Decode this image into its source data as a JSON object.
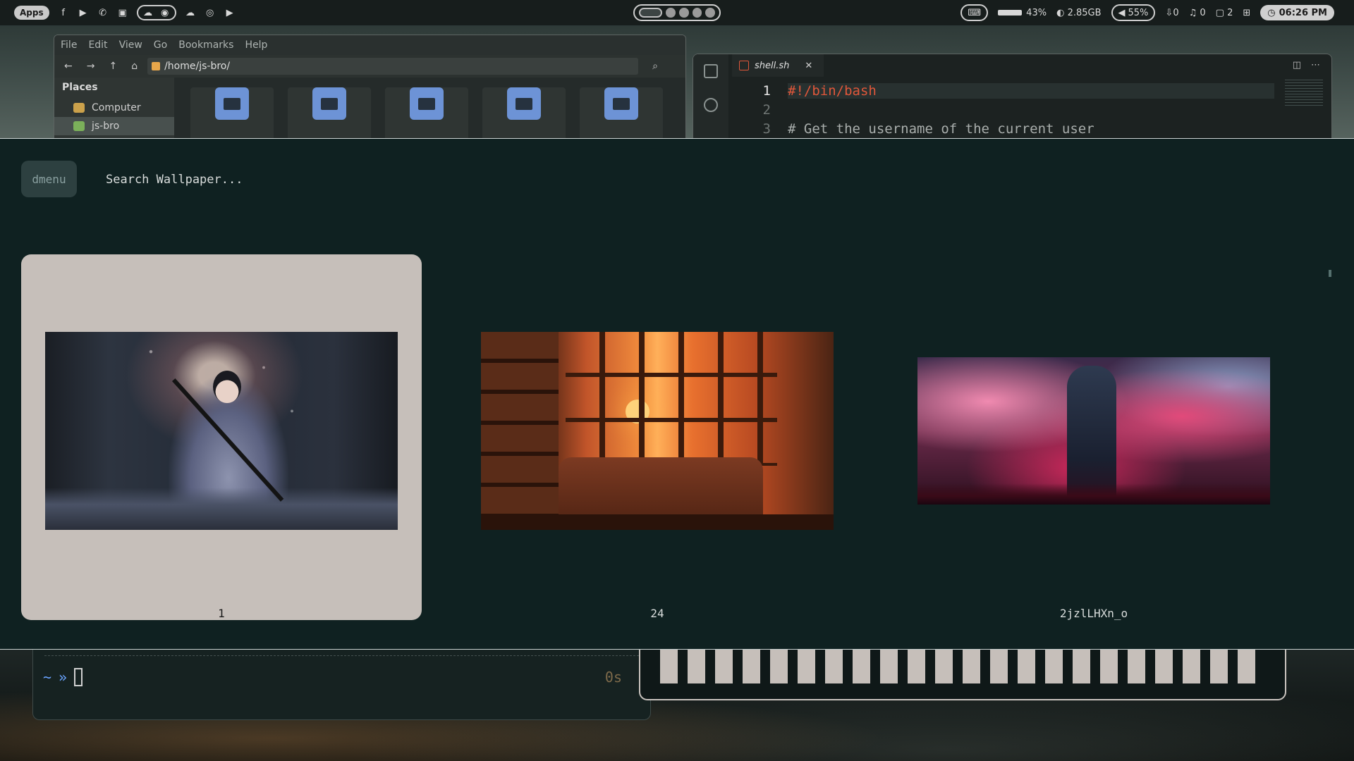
{
  "topbar": {
    "apps_label": "Apps",
    "battery": "43%",
    "memory": "2.85GB",
    "volume": "55%",
    "downloads": "0",
    "notifications": "0",
    "clipboard": "2",
    "clock": "06:26 PM"
  },
  "file_manager": {
    "menu": [
      "File",
      "Edit",
      "View",
      "Go",
      "Bookmarks",
      "Help"
    ],
    "path": "/home/js-bro/",
    "places_title": "Places",
    "places": [
      "Computer",
      "js-bro"
    ]
  },
  "editor": {
    "tab_name": "shell.sh",
    "lines": [
      {
        "num": "1",
        "text": "#!/bin/bash"
      },
      {
        "num": "2",
        "text": ""
      },
      {
        "num": "3",
        "text": "# Get the username of the current user"
      }
    ]
  },
  "picker": {
    "tag": "dmenu",
    "placeholder": "Search Wallpaper...",
    "items": [
      {
        "label": "1"
      },
      {
        "label": "24"
      },
      {
        "label": "2jzlLHXn_o"
      }
    ]
  },
  "terminal": {
    "prompt_dir": "~",
    "prompt_arrow": "»",
    "duration": "0s"
  }
}
